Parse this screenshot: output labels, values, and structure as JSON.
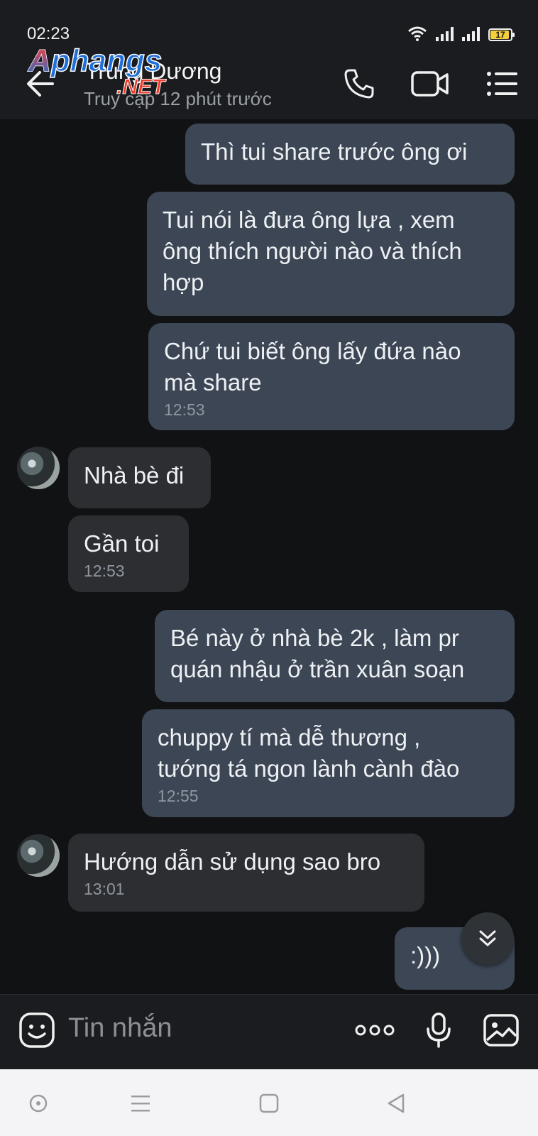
{
  "status_bar": {
    "time": "02:23",
    "battery": "17",
    "battery_color": "#f4cf3b"
  },
  "header": {
    "contact_name": "Trung Dương",
    "contact_status": "Truy cập 12 phút trước",
    "watermark_logo": "Aphangs.NET",
    "back_icon": "arrow-left-icon",
    "call_icon": "phone-icon",
    "video_icon": "video-camera-icon",
    "menu_icon": "list-menu-icon"
  },
  "messages": [
    {
      "direction": "out",
      "text": "Thì tui share trước ông ơi",
      "time": ""
    },
    {
      "direction": "out",
      "text": "Tui nói là đưa ông lựa , xem\nông thích người nào và thích\nhợp",
      "time": ""
    },
    {
      "direction": "out",
      "text": "Chứ tui biết ông lấy đứa nào\nmà share",
      "time": "12:53"
    },
    {
      "direction": "in",
      "text": "Nhà bè đi",
      "time": ""
    },
    {
      "direction": "in",
      "text": "Gần toi",
      "time": "12:53"
    },
    {
      "direction": "out",
      "text": "Bé này ở nhà bè 2k , làm pr\nquán nhậu ở trần xuân soạn",
      "time": ""
    },
    {
      "direction": "out",
      "text": "chuppy tí mà dễ thương ,\ntướng tá ngon lành cành đào",
      "time": "12:55"
    },
    {
      "direction": "in",
      "text": "Hướng dẫn sử dụng sao bro",
      "time": "13:01"
    },
    {
      "direction": "out",
      "text": ":)))",
      "time": ""
    }
  ],
  "composer": {
    "placeholder": "Tin nhắn",
    "emoji_icon": "emoji-icon",
    "more_icon": "more-dots-icon",
    "mic_icon": "microphone-icon",
    "image_icon": "image-icon"
  },
  "colors": {
    "outgoing_bubble": "#3c4654",
    "incoming_bubble": "#2d2e31",
    "background": "#111214"
  }
}
